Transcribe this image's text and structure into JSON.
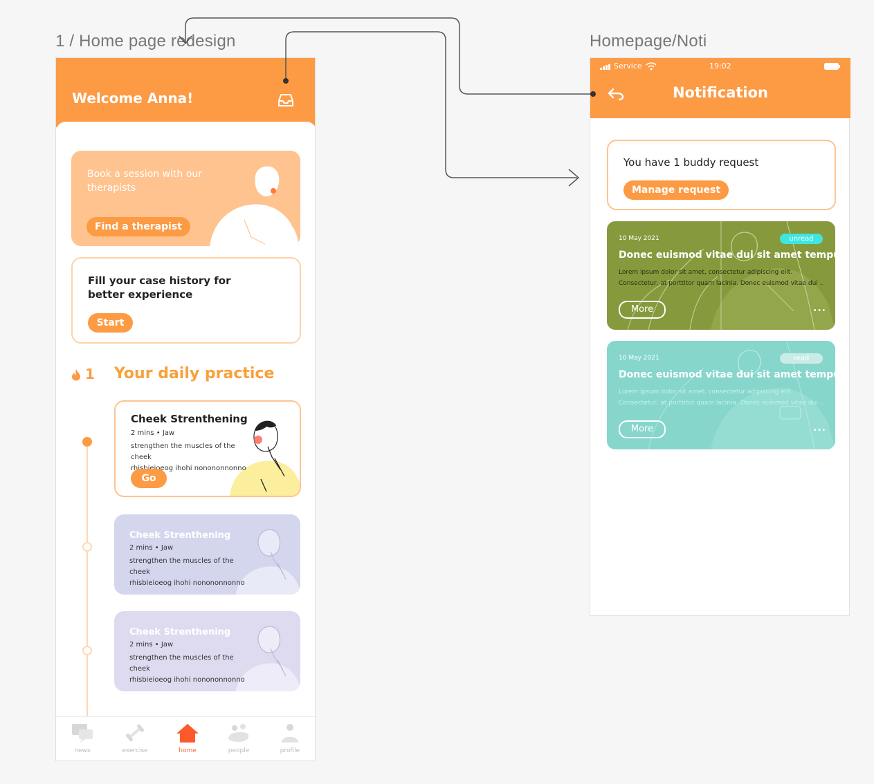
{
  "frames": {
    "home_title": "1 / Home page redesign",
    "noti_title": "Homepage/Noti"
  },
  "home": {
    "welcome": "Welcome Anna!",
    "therapist_card": {
      "text": "Book a session with our therapists",
      "button": "Find a therapist"
    },
    "history_card": {
      "text": "Fill your case history for better experience",
      "button": "Start"
    },
    "streak_count": "1",
    "daily_title": "Your daily practice",
    "exercises": [
      {
        "title": "Cheek Strenthening",
        "meta": "2 mins • Jaw",
        "desc_line1": "strengthen the muscles of the cheek",
        "desc_line2": "rhisbieioeog ihohi nonononnonno",
        "button": "Go"
      },
      {
        "title": "Cheek Strenthening",
        "meta": "2 mins • Jaw",
        "desc_line1": "strengthen the muscles of the cheek",
        "desc_line2": "rhisbieioeog ihohi nonononnonno"
      },
      {
        "title": "Cheek Strenthening",
        "meta": "2 mins • Jaw",
        "desc_line1": "strengthen the muscles of the cheek",
        "desc_line2": "rhisbieioeog ihohi nonononnonno"
      }
    ],
    "nav": [
      {
        "label": "news",
        "icon": "chat-icon"
      },
      {
        "label": "exercise",
        "icon": "dumbbell-icon"
      },
      {
        "label": "home",
        "icon": "home-icon",
        "active": true
      },
      {
        "label": "people",
        "icon": "people-icon"
      },
      {
        "label": "profile",
        "icon": "profile-icon"
      }
    ]
  },
  "noti": {
    "status_carrier": "Service",
    "status_time": "19:02",
    "title": "Notification",
    "buddy_text": "You have 1 buddy request",
    "manage_button": "Manage request",
    "cards": [
      {
        "date": "10 May 2021",
        "badge": "unread",
        "title": "Donec euismod vitae dui sit amet tempus",
        "body_line1": "Lorem ipsum dolor sit amet, consectetur adipiscing elit.",
        "body_line2": "Consectetur, at porttitor quam lacinia. Donec euismod vitae dui ...",
        "more": "More",
        "dots": "..."
      },
      {
        "date": "10 May 2021",
        "badge": "read",
        "title": "Donec euismod vitae dui sit amet tempus",
        "body_line1": "Lorem ipsum dolor sit amet, consectetur adipiscing elit.",
        "body_line2": "Consectetur, at porttitor quam lacinia. Donec euismod vitae dui ...",
        "more": "More",
        "dots": "..."
      }
    ]
  },
  "colors": {
    "brand_orange": "#fd9a44",
    "light_orange": "#ffc38f",
    "olive_card": "#869a3d",
    "teal_card": "#87d6cc",
    "unread_badge": "#3ee6e0",
    "read_badge": "#c9ece6"
  }
}
